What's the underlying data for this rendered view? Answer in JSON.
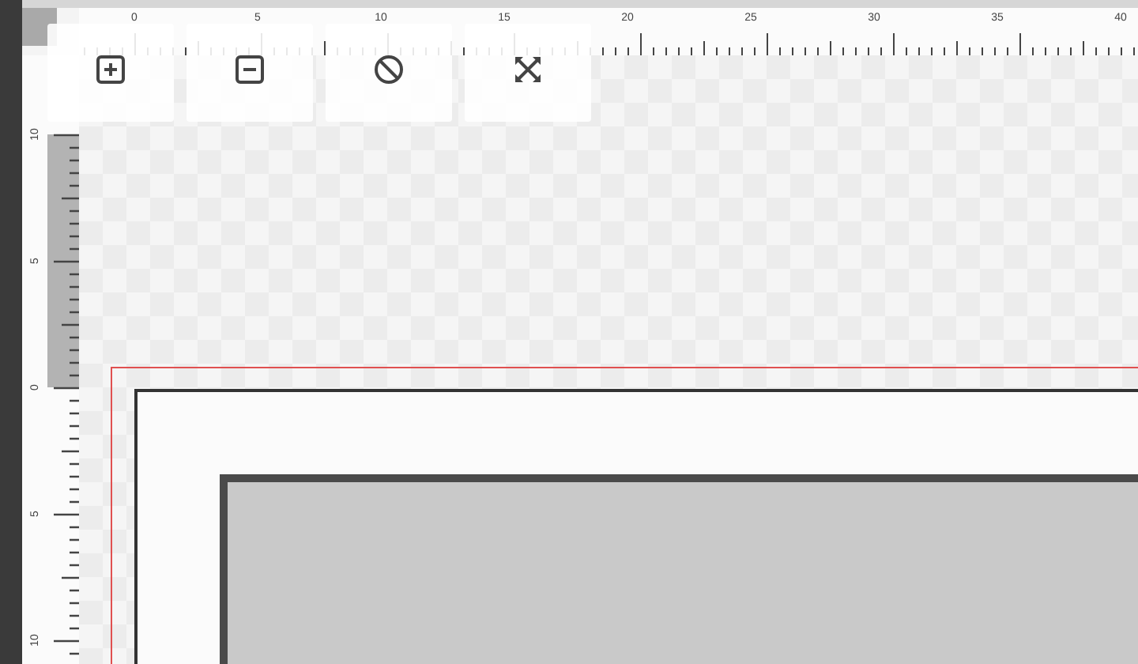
{
  "toolbar": [
    {
      "kind": "zoom-in"
    },
    {
      "kind": "zoom-out"
    },
    {
      "kind": "reset"
    },
    {
      "kind": "fit"
    }
  ],
  "top_ruler": {
    "labels": [
      "0",
      "5",
      "10",
      "15",
      "20",
      "25",
      "30",
      "35",
      "40"
    ]
  },
  "left_ruler": {
    "labels": [
      "10",
      "5",
      "0",
      "5",
      "10"
    ]
  }
}
